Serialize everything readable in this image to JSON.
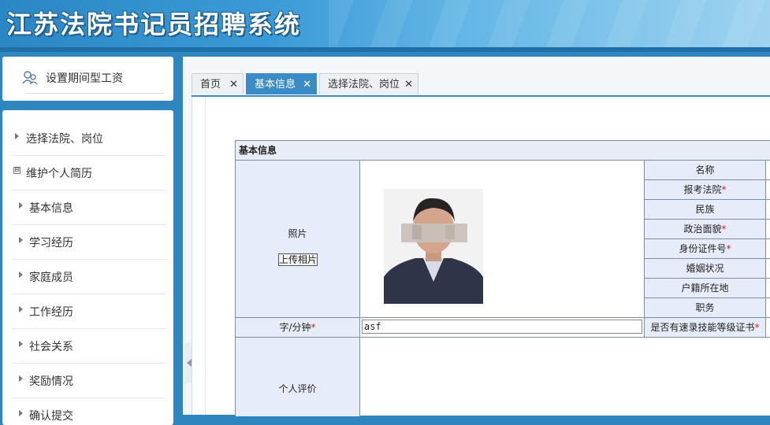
{
  "header": {
    "title": "江苏法院书记员招聘系统"
  },
  "sidebar_top": {
    "icon": "users-icon",
    "label": "设置期间型工资"
  },
  "sidebar": {
    "items": [
      {
        "label": "选择法院、岗位",
        "type": "leaf"
      },
      {
        "label": "维护个人简历",
        "type": "group",
        "toggle": "⊟"
      },
      {
        "label": "基本信息",
        "type": "sub"
      },
      {
        "label": "学习经历",
        "type": "sub"
      },
      {
        "label": "家庭成员",
        "type": "sub"
      },
      {
        "label": "工作经历",
        "type": "sub"
      },
      {
        "label": "社会关系",
        "type": "sub"
      },
      {
        "label": "奖励情况",
        "type": "sub"
      },
      {
        "label": "确认提交",
        "type": "sub"
      }
    ]
  },
  "tabs": [
    {
      "label": "首页",
      "close": "✕",
      "active": false
    },
    {
      "label": "基本信息",
      "close": "✕",
      "active": true
    },
    {
      "label": "选择法院、岗位",
      "close": "✕",
      "active": false
    }
  ],
  "form": {
    "section_title": "基本信息",
    "photo_label": "照片",
    "upload_button": "上传相片",
    "right_fields": [
      {
        "label": "名称",
        "required": false
      },
      {
        "label": "报考法院",
        "required": true
      },
      {
        "label": "民族",
        "required": false
      },
      {
        "label": "政治面貌",
        "required": true
      },
      {
        "label": "身份证件号",
        "required": true
      },
      {
        "label": "婚姻状况",
        "required": false
      },
      {
        "label": "户籍所在地",
        "required": false
      },
      {
        "label": "职务",
        "required": false
      }
    ],
    "typing_label": "字/分钟",
    "typing_value": "asf",
    "cert_label": "是否有速录技能等级证书",
    "evaluation_label": "个人评价",
    "required_mark": "*"
  },
  "colors": {
    "accent": "#3b8cc6",
    "label_bg": "#e6ecfa",
    "required": "#dd2222"
  }
}
